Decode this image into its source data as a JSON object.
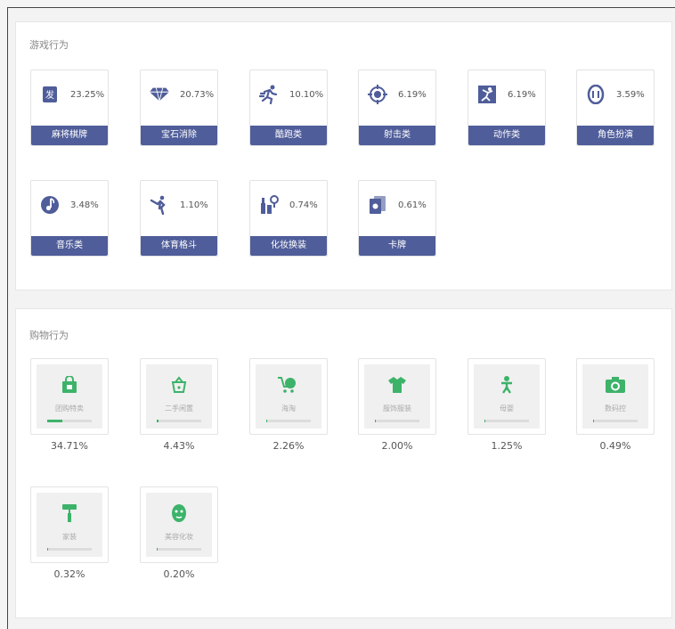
{
  "game_section": {
    "title": "游戏行为",
    "items": [
      {
        "label": "麻将棋牌",
        "percent": "23.25%",
        "icon": "mahjong-tile-icon"
      },
      {
        "label": "宝石消除",
        "percent": "20.73%",
        "icon": "diamond-icon"
      },
      {
        "label": "酷跑类",
        "percent": "10.10%",
        "icon": "running-man-icon"
      },
      {
        "label": "射击类",
        "percent": "6.19%",
        "icon": "crosshair-target-icon"
      },
      {
        "label": "动作类",
        "percent": "6.19%",
        "icon": "action-figure-icon"
      },
      {
        "label": "角色扮演",
        "percent": "3.59%",
        "icon": "mask-face-icon"
      },
      {
        "label": "音乐类",
        "percent": "3.48%",
        "icon": "music-note-icon"
      },
      {
        "label": "体育格斗",
        "percent": "1.10%",
        "icon": "martial-arts-icon"
      },
      {
        "label": "化妆换装",
        "percent": "0.74%",
        "icon": "makeup-icon"
      },
      {
        "label": "卡牌",
        "percent": "0.61%",
        "icon": "playing-cards-icon"
      }
    ]
  },
  "shop_section": {
    "title": "购物行为",
    "items": [
      {
        "label": "团购特卖",
        "percent": "34.71%",
        "icon": "shopping-bag-icon",
        "fill": 0.3471
      },
      {
        "label": "二手闲置",
        "percent": "4.43%",
        "icon": "basket-icon",
        "fill": 0.0443
      },
      {
        "label": "海淘",
        "percent": "2.26%",
        "icon": "globe-cart-icon",
        "fill": 0.0226
      },
      {
        "label": "服饰服装",
        "percent": "2.00%",
        "icon": "tshirt-icon",
        "fill": 0.02
      },
      {
        "label": "母婴",
        "percent": "1.25%",
        "icon": "baby-icon",
        "fill": 0.0125
      },
      {
        "label": "数码控",
        "percent": "0.49%",
        "icon": "camera-icon",
        "fill": 0.0049
      },
      {
        "label": "家装",
        "percent": "0.32%",
        "icon": "paint-roller-icon",
        "fill": 0.0032
      },
      {
        "label": "美容化妆",
        "percent": "0.20%",
        "icon": "face-mask-icon",
        "fill": 0.002
      }
    ]
  },
  "colors": {
    "game_accent": "#4f5d9a",
    "shop_accent": "#3db36a"
  }
}
